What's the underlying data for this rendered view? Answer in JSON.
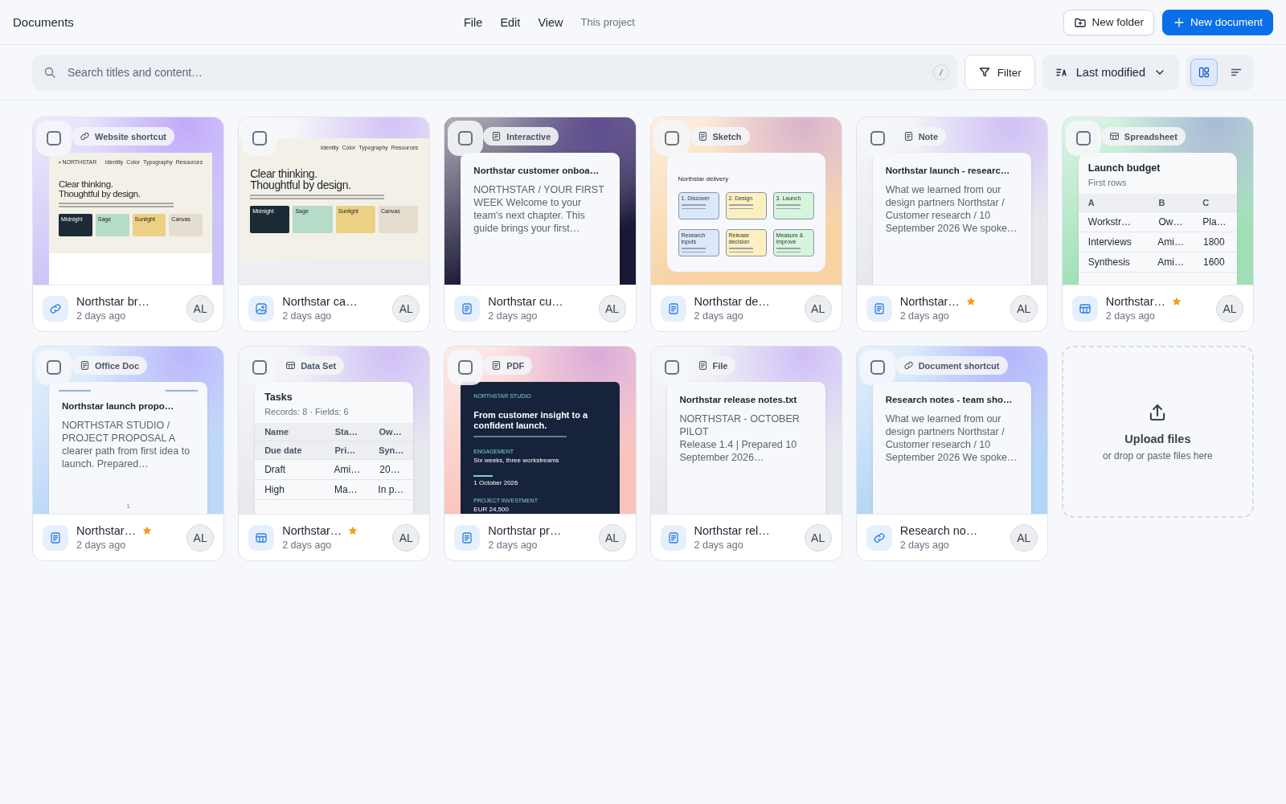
{
  "app_title": "Documents",
  "menu": [
    {
      "label": "File",
      "kind": "menu"
    },
    {
      "label": "Edit",
      "kind": "menu"
    },
    {
      "label": "View",
      "kind": "menu"
    },
    {
      "label": "This project",
      "kind": "scope"
    }
  ],
  "actions": [
    {
      "label": "New folder",
      "kind": "secondary"
    },
    {
      "label": "New document",
      "kind": "primary"
    }
  ],
  "search": {
    "placeholder": "Search titles and content…",
    "shortcut": "/"
  },
  "filter": "Filter",
  "sort": {
    "value": "Last modified"
  },
  "views": [
    {
      "kind": "grid",
      "selected": true
    },
    {
      "kind": "list",
      "selected": false
    }
  ],
  "cards": [
    {
      "kind": "link",
      "type_label": "Website shortcut",
      "color": "#cbc3f6",
      "checked": false,
      "title": "Northstar br…",
      "starred": false,
      "time": "2 days ago",
      "owner": "AL",
      "preview": {
        "kind": "site",
        "framed": true,
        "brand": "• NORTHSTAR",
        "nav": [
          "Identity",
          "Color",
          "Typography",
          "Resources"
        ],
        "headline": [
          "Clear thinking.",
          "Thoughtful by design."
        ],
        "swatches": [
          {
            "name": "Midnight",
            "color": "#1b2a35"
          },
          {
            "name": "Sage",
            "color": "#b5dcc8"
          },
          {
            "name": "Sunlight",
            "color": "#ecd185"
          },
          {
            "name": "Canvas",
            "color": "#e4ddd0"
          }
        ]
      }
    },
    {
      "kind": "image",
      "color": "#eceef2",
      "checked": false,
      "title": "Northstar ca…",
      "starred": false,
      "time": "2 days ago",
      "owner": "AL",
      "preview": {
        "kind": "site",
        "framed": false,
        "nav": [
          "Identity",
          "Color",
          "Typography",
          "Resources"
        ],
        "headline": [
          "Clear thinking.",
          "Thoughtful by design."
        ],
        "swatches": [
          {
            "name": "Midnight",
            "color": "#1b2a35"
          },
          {
            "name": "Sage",
            "color": "#b5dcc8"
          },
          {
            "name": "Sunlight",
            "color": "#ecd185"
          },
          {
            "name": "Canvas",
            "color": "#e4ddd0"
          }
        ]
      }
    },
    {
      "kind": "doc",
      "type_label": "Interactive",
      "color": "#1a1836",
      "checked": false,
      "title": "Northstar cu…",
      "starred": false,
      "time": "2 days ago",
      "owner": "AL",
      "preview": {
        "kind": "doc",
        "heading": "Northstar customer onboa…",
        "body": "NORTHSTAR / YOUR FIRST WEEK Welcome to your team's next chapter. This guide brings your first…"
      }
    },
    {
      "kind": "doc",
      "type_label": "Sketch",
      "color": "#f8d3a3",
      "checked": false,
      "title": "Northstar de…",
      "starred": false,
      "time": "2 days ago",
      "owner": "AL",
      "preview": {
        "kind": "sketch",
        "heading": "Northstar delivery",
        "nodes": [
          {
            "label": "1. Discover",
            "color": "#dbe7fb"
          },
          {
            "label": "2. Design",
            "color": "#fdf0c0"
          },
          {
            "label": "3. Launch",
            "color": "#d7f5dd"
          },
          {
            "label": "Research inputs",
            "color": "#dbe7fb"
          },
          {
            "label": "Release decision",
            "color": "#fdf0c0"
          },
          {
            "label": "Measure & improve",
            "color": "#d7f5dd"
          }
        ]
      }
    },
    {
      "kind": "doc",
      "type_label": "Note",
      "color": "#e6e8ee",
      "checked": false,
      "title": "Northstar…",
      "starred": true,
      "time": "2 days ago",
      "owner": "AL",
      "preview": {
        "kind": "doc",
        "heading": "Northstar launch - researc…",
        "body": "What we learned from our design partners Northstar / Customer research / 10 September 2026 We spoke…"
      }
    },
    {
      "kind": "table",
      "type_label": "Spreadsheet",
      "color": "#9fe0b6",
      "checked": false,
      "title": "Northstar…",
      "starred": true,
      "time": "2 days ago",
      "owner": "AL",
      "preview": {
        "kind": "sheet",
        "heading": "Launch budget",
        "subheading": "First rows",
        "header": [
          [
            "A",
            "B",
            "C"
          ]
        ],
        "rows": [
          [
            "Workstr…",
            "Ow…",
            "Pla…"
          ],
          [
            "Interviews",
            "Ami…",
            "1800"
          ],
          [
            "Synthesis",
            "Ami…",
            "1600"
          ]
        ]
      }
    },
    {
      "kind": "doc",
      "type_label": "Office Doc",
      "color": "#bcd9f8",
      "checked": false,
      "title": "Northstar…",
      "starred": true,
      "time": "2 days ago",
      "owner": "AL",
      "preview": {
        "kind": "doc",
        "rules": true,
        "heading": "Northstar launch propo…",
        "body": "NORTHSTAR STUDIO / PROJECT PROPOSAL A clearer path from first idea to launch. Prepared…",
        "page_number": "1"
      }
    },
    {
      "kind": "table",
      "type_label": "Data Set",
      "color": "#e6e8ee",
      "checked": false,
      "title": "Northstar…",
      "starred": true,
      "time": "2 days ago",
      "owner": "AL",
      "preview": {
        "kind": "sheet",
        "heading": "Tasks",
        "subheading": "Records: 8 · Fields: 6",
        "header": [
          [
            "Name",
            "Sta…",
            "Ow…"
          ],
          [
            "Due date",
            "Pri…",
            "Syn…"
          ]
        ],
        "rows": [
          [
            "Draft",
            "Ami…",
            "20…"
          ],
          [
            "High",
            "Ma…",
            "In p…"
          ]
        ]
      }
    },
    {
      "kind": "doc",
      "type_label": "PDF",
      "color": "#fbc3bb",
      "checked": false,
      "title": "Northstar pr…",
      "starred": false,
      "time": "2 days ago",
      "owner": "AL",
      "preview": {
        "kind": "pdf",
        "eyebrow": "NORTHSTAR STUDIO",
        "headline": "From customer insight to a confident launch.",
        "sections": [
          {
            "label": "ENGAGEMENT",
            "value": "Six weeks, three workstreams"
          },
          {
            "value": "1 October 2026"
          },
          {
            "label": "PROJECT INVESTMENT",
            "value": "EUR 24,500"
          }
        ]
      }
    },
    {
      "kind": "doc",
      "type_label": "File",
      "color": "#e6e8ee",
      "checked": false,
      "title": "Northstar rel…",
      "starred": false,
      "time": "2 days ago",
      "owner": "AL",
      "preview": {
        "kind": "doc",
        "heading": "Northstar release notes.txt",
        "body": "NORTHSTAR - OCTOBER PILOT\nRelease 1.4 | Prepared 10 September 2026…"
      }
    },
    {
      "kind": "link",
      "type_label": "Document shortcut",
      "color": "#b3d5f6",
      "checked": false,
      "title": "Research no…",
      "starred": false,
      "time": "2 days ago",
      "owner": "AL",
      "preview": {
        "kind": "doc",
        "heading": "Research notes - team sho…",
        "body": "What we learned from our design partners Northstar / Customer research / 10 September 2026 We spoke…"
      }
    }
  ],
  "upload": {
    "title": "Upload files",
    "hint": "or drop or paste files here"
  }
}
